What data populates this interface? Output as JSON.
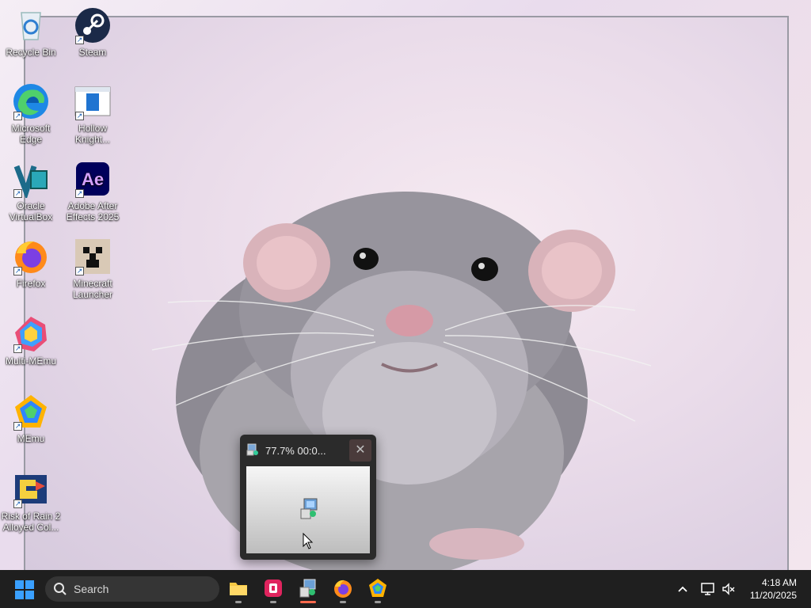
{
  "desktop": {
    "icons": [
      {
        "label": "Recycle Bin",
        "icon": "recycle-bin-icon",
        "shortcut": false
      },
      {
        "label": "Steam",
        "icon": "steam-icon",
        "shortcut": true
      },
      {
        "label": "Microsoft Edge",
        "icon": "edge-icon",
        "shortcut": true
      },
      {
        "label": "Hollow Knight...",
        "icon": "hollow-knight-icon",
        "shortcut": true
      },
      {
        "label": "Oracle VirtualBox",
        "icon": "virtualbox-icon",
        "shortcut": true
      },
      {
        "label": "Adobe After Effects 2025",
        "icon": "after-effects-icon",
        "shortcut": true
      },
      {
        "label": "Firefox",
        "icon": "firefox-icon",
        "shortcut": true
      },
      {
        "label": "Minecraft Launcher",
        "icon": "minecraft-icon",
        "shortcut": true
      },
      {
        "label": "Multi-MEmu",
        "icon": "multi-memu-icon",
        "shortcut": true
      },
      {
        "label": "MEmu",
        "icon": "memu-icon",
        "shortcut": true
      },
      {
        "label": "Risk of Rain 2 Alloyed Col...",
        "icon": "risk-of-rain-icon",
        "shortcut": true
      }
    ],
    "ae_glyph": "Ae"
  },
  "progress_window": {
    "title": "77.7%   00:0...",
    "close_glyph": "✕"
  },
  "taskbar": {
    "search_label": "Search",
    "apps": [
      "file-explorer",
      "media-player",
      "installer",
      "firefox",
      "memu"
    ],
    "active_app": "installer",
    "clock_time": "4:18 AM",
    "clock_date": "11/20/2025"
  }
}
